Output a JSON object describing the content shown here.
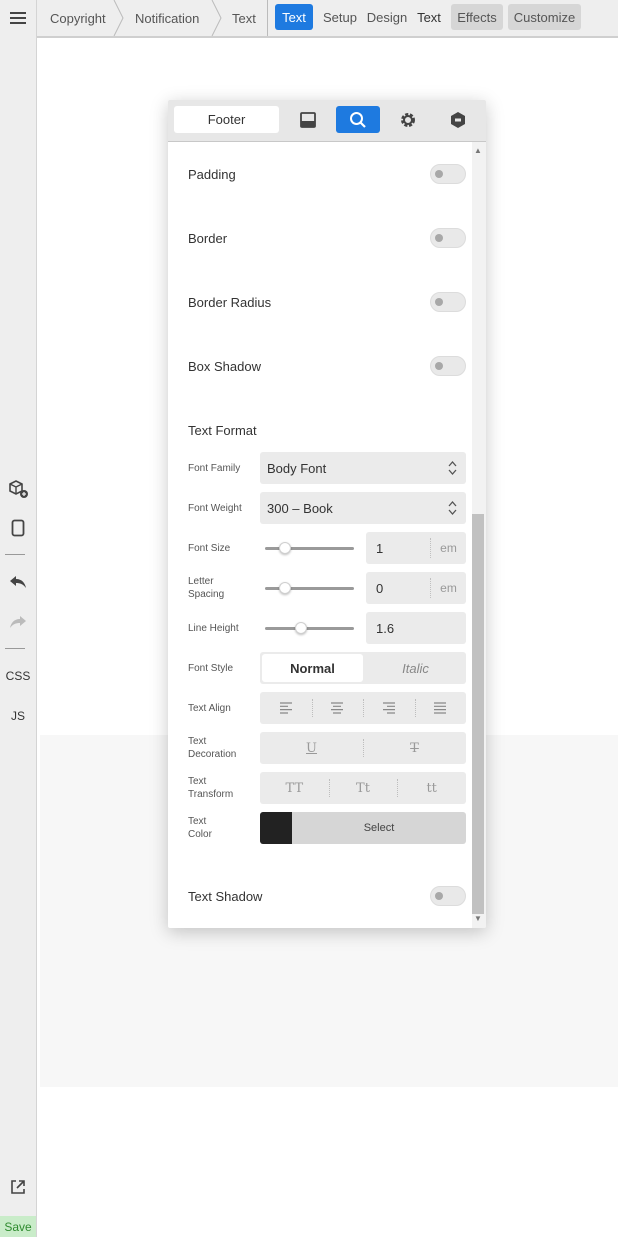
{
  "sidebar": {
    "css_label": "CSS",
    "js_label": "JS",
    "save_label": "Save",
    "icons": [
      "add-block-icon",
      "device-icon",
      "undo-icon",
      "redo-icon",
      "external-link-icon"
    ]
  },
  "breadcrumbs": [
    "Copyright",
    "Notification",
    "Text"
  ],
  "toolbar": {
    "text_tab": "Text",
    "setup_tab": "Setup",
    "design_tab": "Design",
    "text2_tab": "Text",
    "effects_tab": "Effects",
    "customize_tab": "Customize"
  },
  "panel": {
    "header_label": "Footer",
    "header_icons": [
      "layout-icon",
      "search-icon",
      "gear-icon",
      "hexagon-icon"
    ],
    "sections": {
      "padding": "Padding",
      "border": "Border",
      "border_radius": "Border Radius",
      "box_shadow": "Box Shadow",
      "text_format": "Text Format",
      "text_shadow": "Text Shadow"
    },
    "font_family": {
      "label": "Font Family",
      "value": "Body Font"
    },
    "font_weight": {
      "label": "Font Weight",
      "value": "300 – Book"
    },
    "font_size": {
      "label": "Font Size",
      "value": "1",
      "unit": "em",
      "slider_fraction": 0.22
    },
    "letter_spacing": {
      "label": "Letter\nSpacing",
      "value": "0",
      "unit": "em",
      "slider_fraction": 0.23
    },
    "line_height": {
      "label": "Line Height",
      "value": "1.6",
      "slider_fraction": 0.4
    },
    "font_style": {
      "label": "Font Style",
      "options": [
        "Normal",
        "Italic"
      ],
      "selected": "Normal"
    },
    "text_align": {
      "label": "Text Align",
      "icons": [
        "align-left-icon",
        "align-center-icon",
        "align-right-icon",
        "align-justify-icon"
      ]
    },
    "text_decoration": {
      "label": "Text\nDecoration",
      "options": [
        "U",
        "T"
      ]
    },
    "text_transform": {
      "label": "Text\nTransform",
      "options": [
        "TT",
        "Tt",
        "tt"
      ]
    },
    "text_color": {
      "label": "Text\nColor",
      "swatch": "#222222",
      "select_label": "Select"
    }
  },
  "colors": {
    "accent": "#1e7ae0",
    "save_bg": "#c9ecc9",
    "save_text": "#2e8b2e"
  }
}
